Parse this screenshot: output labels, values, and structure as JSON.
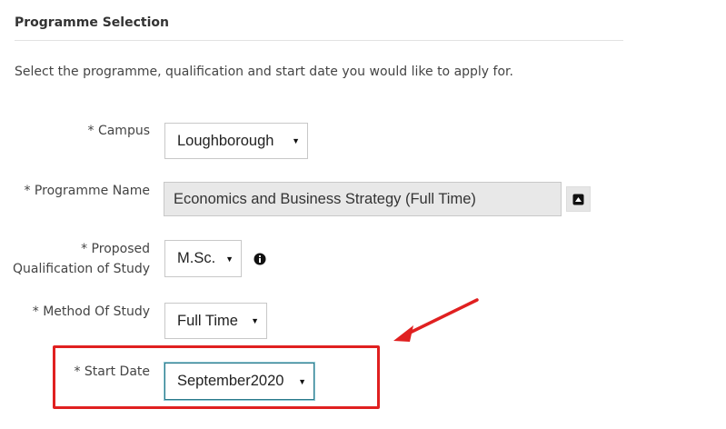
{
  "section": {
    "title": "Programme Selection",
    "intro": "Select the programme, qualification and start date you would like to apply for."
  },
  "fields": {
    "campus": {
      "label": "*  Campus",
      "value": "Loughborough"
    },
    "programme_name": {
      "label": "*  Programme Name",
      "value": "Economics and Business Strategy (Full Time)"
    },
    "qualification": {
      "label_line1": "*  Proposed",
      "label_line2": "Qualification of Study",
      "value": "M.Sc."
    },
    "method_of_study": {
      "label": "*  Method Of Study",
      "value": "Full Time"
    },
    "start_date": {
      "label": "*  Start Date",
      "value": "September2020"
    }
  },
  "icons": {
    "dropdown": "caret-down-icon",
    "lookup": "expand-up-icon",
    "info": "info-icon"
  },
  "colors": {
    "annotation": "#e02020",
    "focus": "#2b7a8c"
  }
}
